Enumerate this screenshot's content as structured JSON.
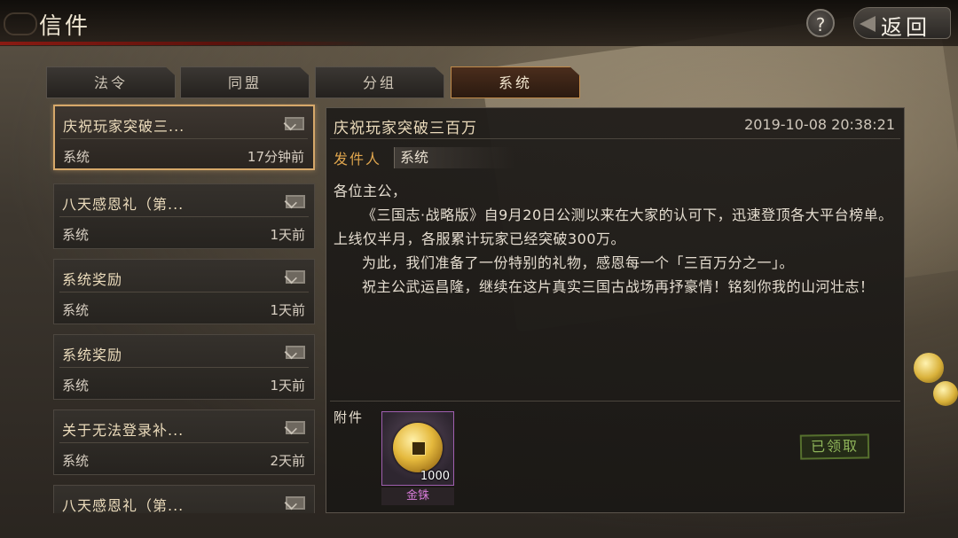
{
  "header": {
    "title": "信件",
    "help_label": "?",
    "back_label": "返回"
  },
  "tabs": [
    {
      "label": "法令",
      "active": false
    },
    {
      "label": "同盟",
      "active": false
    },
    {
      "label": "分组",
      "active": false
    },
    {
      "label": "系统",
      "active": true
    }
  ],
  "mail_list": [
    {
      "title": "庆祝玩家突破三...",
      "sender": "系统",
      "time": "17分钟前",
      "selected": true
    },
    {
      "title": "八天感恩礼（第...",
      "sender": "系统",
      "time": "1天前",
      "selected": false
    },
    {
      "title": "系统奖励",
      "sender": "系统",
      "time": "1天前",
      "selected": false
    },
    {
      "title": "系统奖励",
      "sender": "系统",
      "time": "1天前",
      "selected": false
    },
    {
      "title": "关于无法登录补...",
      "sender": "系统",
      "time": "2天前",
      "selected": false
    },
    {
      "title": "八天感恩礼（第...",
      "sender": "",
      "time": "",
      "selected": false
    }
  ],
  "mail": {
    "title": "庆祝玩家突破三百万",
    "date": "2019-10-08 20:38:21",
    "sender_label": "发件人",
    "sender": "系统",
    "greeting": "各位主公，",
    "paragraph1": "《三国志·战略版》自9月20日公测以来在大家的认可下，迅速登顶各大平台榜单。上线仅半月，各服累计玩家已经突破300万。",
    "paragraph2": "为此，我们准备了一份特别的礼物，感恩每一个「三百万分之一」。",
    "paragraph3": "祝主公武运昌隆，继续在这片真实三国古战场再抒豪情！铭刻你我的山河壮志！"
  },
  "attachment": {
    "label": "附件",
    "item_name": "金铢",
    "quantity": "1000",
    "item_icon": "gold-coin-icon",
    "claimed_label": "已领取"
  },
  "colors": {
    "accent_gold": "#d6a86a",
    "sender_label": "#e0a64e",
    "item_rarity_purple": "#d77bd8",
    "claimed_green": "#8fb55a"
  }
}
